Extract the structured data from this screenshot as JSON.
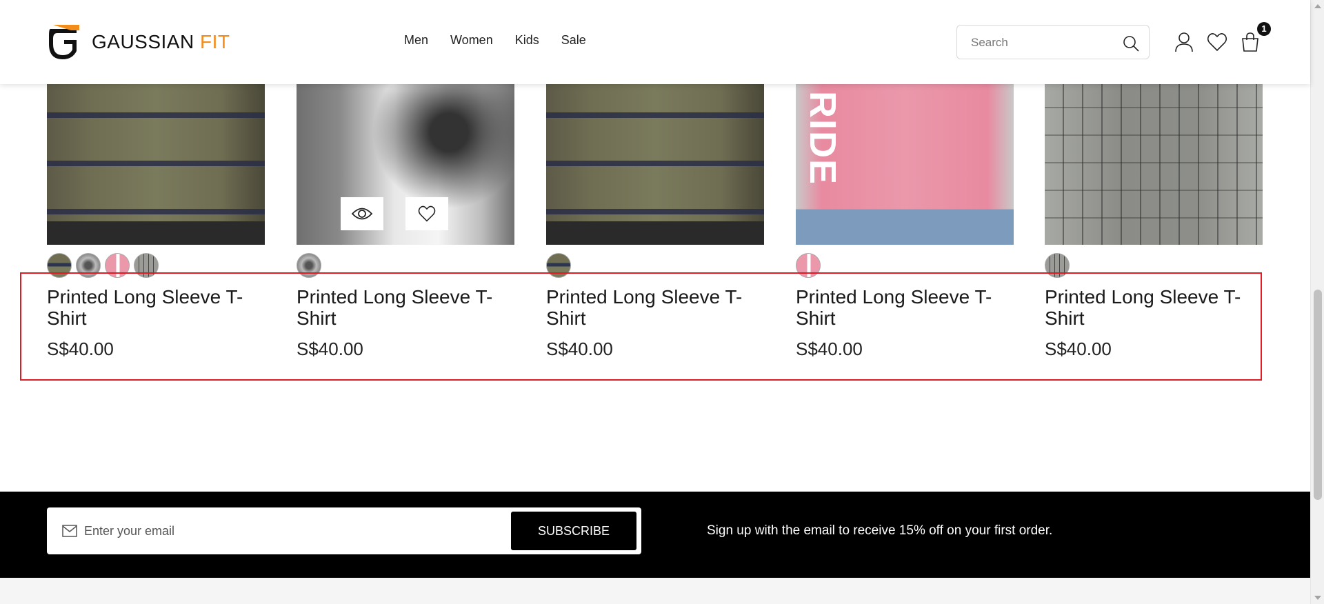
{
  "brand": {
    "name_main": "GAUSSIAN ",
    "name_accent": "FIT",
    "accent_color": "#f28c1b"
  },
  "nav": {
    "items": [
      {
        "label": "Men"
      },
      {
        "label": "Women"
      },
      {
        "label": "Kids"
      },
      {
        "label": "Sale"
      }
    ]
  },
  "search": {
    "placeholder": "Search"
  },
  "cart": {
    "count": "1"
  },
  "products": [
    {
      "title": "Printed Long Sleeve T-Shirt",
      "price": "S$40.00",
      "image": "olive-printed-tee",
      "swatches": [
        "olive",
        "splatter",
        "pink",
        "grey"
      ]
    },
    {
      "title": "Printed Long Sleeve T-Shirt",
      "price": "S$40.00",
      "image": "splatter-printed-tee",
      "swatches": [
        "splatter"
      ],
      "hover_actions": [
        "eye-icon",
        "heart-icon"
      ]
    },
    {
      "title": "Printed Long Sleeve T-Shirt",
      "price": "S$40.00",
      "image": "olive-printed-tee",
      "swatches": [
        "olive"
      ]
    },
    {
      "title": "Printed Long Sleeve T-Shirt",
      "price": "S$40.00",
      "image": "pink-ride-tee",
      "swatches": [
        "pink"
      ],
      "image_text": "RIDE"
    },
    {
      "title": "Printed Long Sleeve T-Shirt",
      "price": "S$40.00",
      "image": "grey-printed-tee",
      "swatches": [
        "grey"
      ]
    }
  ],
  "newsletter": {
    "placeholder": "Enter your email",
    "button_label": "SUBSCRIBE",
    "message": "Sign up with the email to receive 15% off on your first order."
  },
  "colors": {
    "highlight_border": "#e01b24",
    "newsletter_bg": "#000000"
  }
}
